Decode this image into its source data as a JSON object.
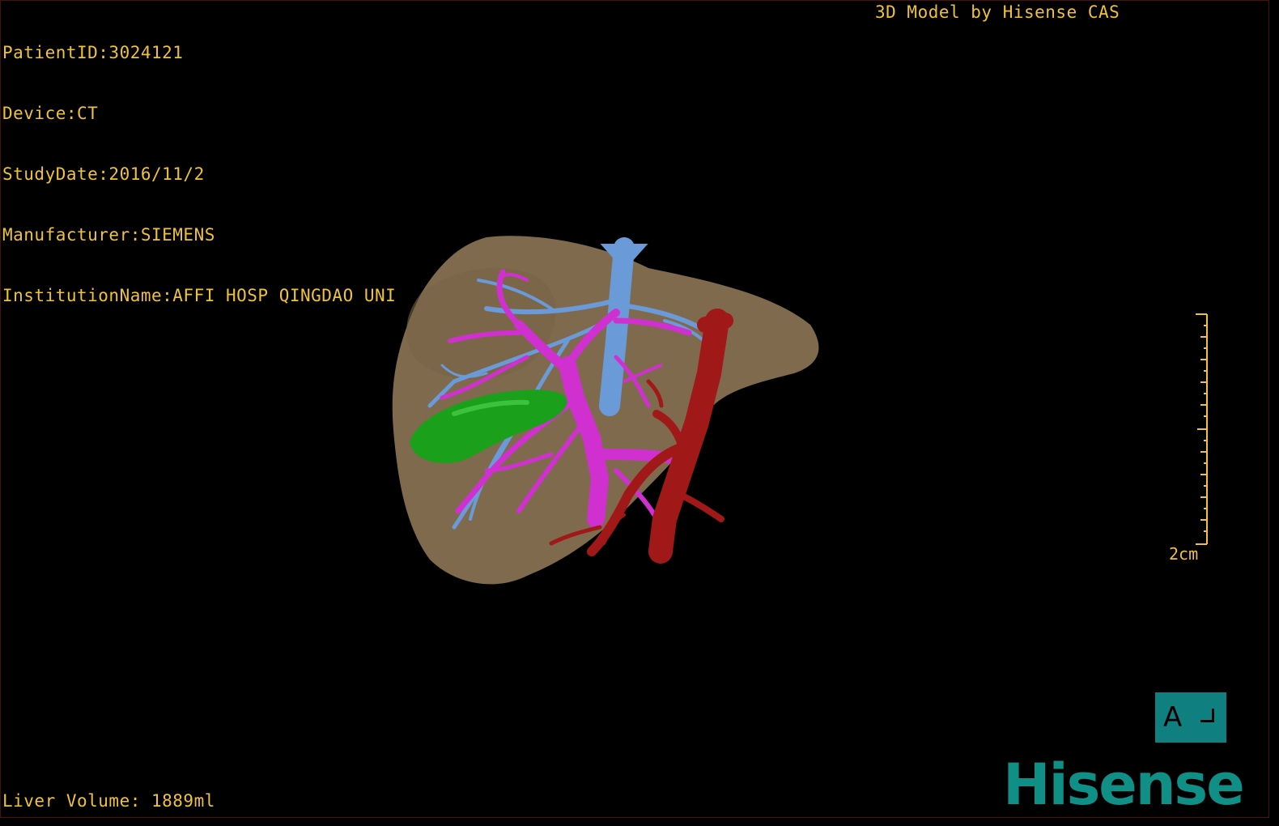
{
  "patient_info": {
    "patient_id": "PatientID:3024121",
    "device": "Device:CT",
    "study_date": "StudyDate:2016/11/2",
    "manufacturer": "Manufacturer:SIEMENS",
    "institution": "InstitutionName:AFFI HOSP QINGDAO UNI"
  },
  "header_right": "3D Model by Hisense CAS",
  "liver_volume": "Liver Volume: 1889ml",
  "scale": {
    "label": "2cm"
  },
  "orientation": {
    "label": "A"
  },
  "logo_text": "Hisense",
  "icons": {
    "orientation": "orientation-cube-icon",
    "scale": "ruler-icon"
  },
  "colors": {
    "overlay_text": "#f0c23a",
    "liver": "#8b7355",
    "portal_vein": "#d030d0",
    "hepatic_vein": "#6a9ad8",
    "artery": "#a01818",
    "gallbladder": "#1aa01a",
    "logo": "#0f8f86",
    "orientation_box": "#0f7f80"
  }
}
